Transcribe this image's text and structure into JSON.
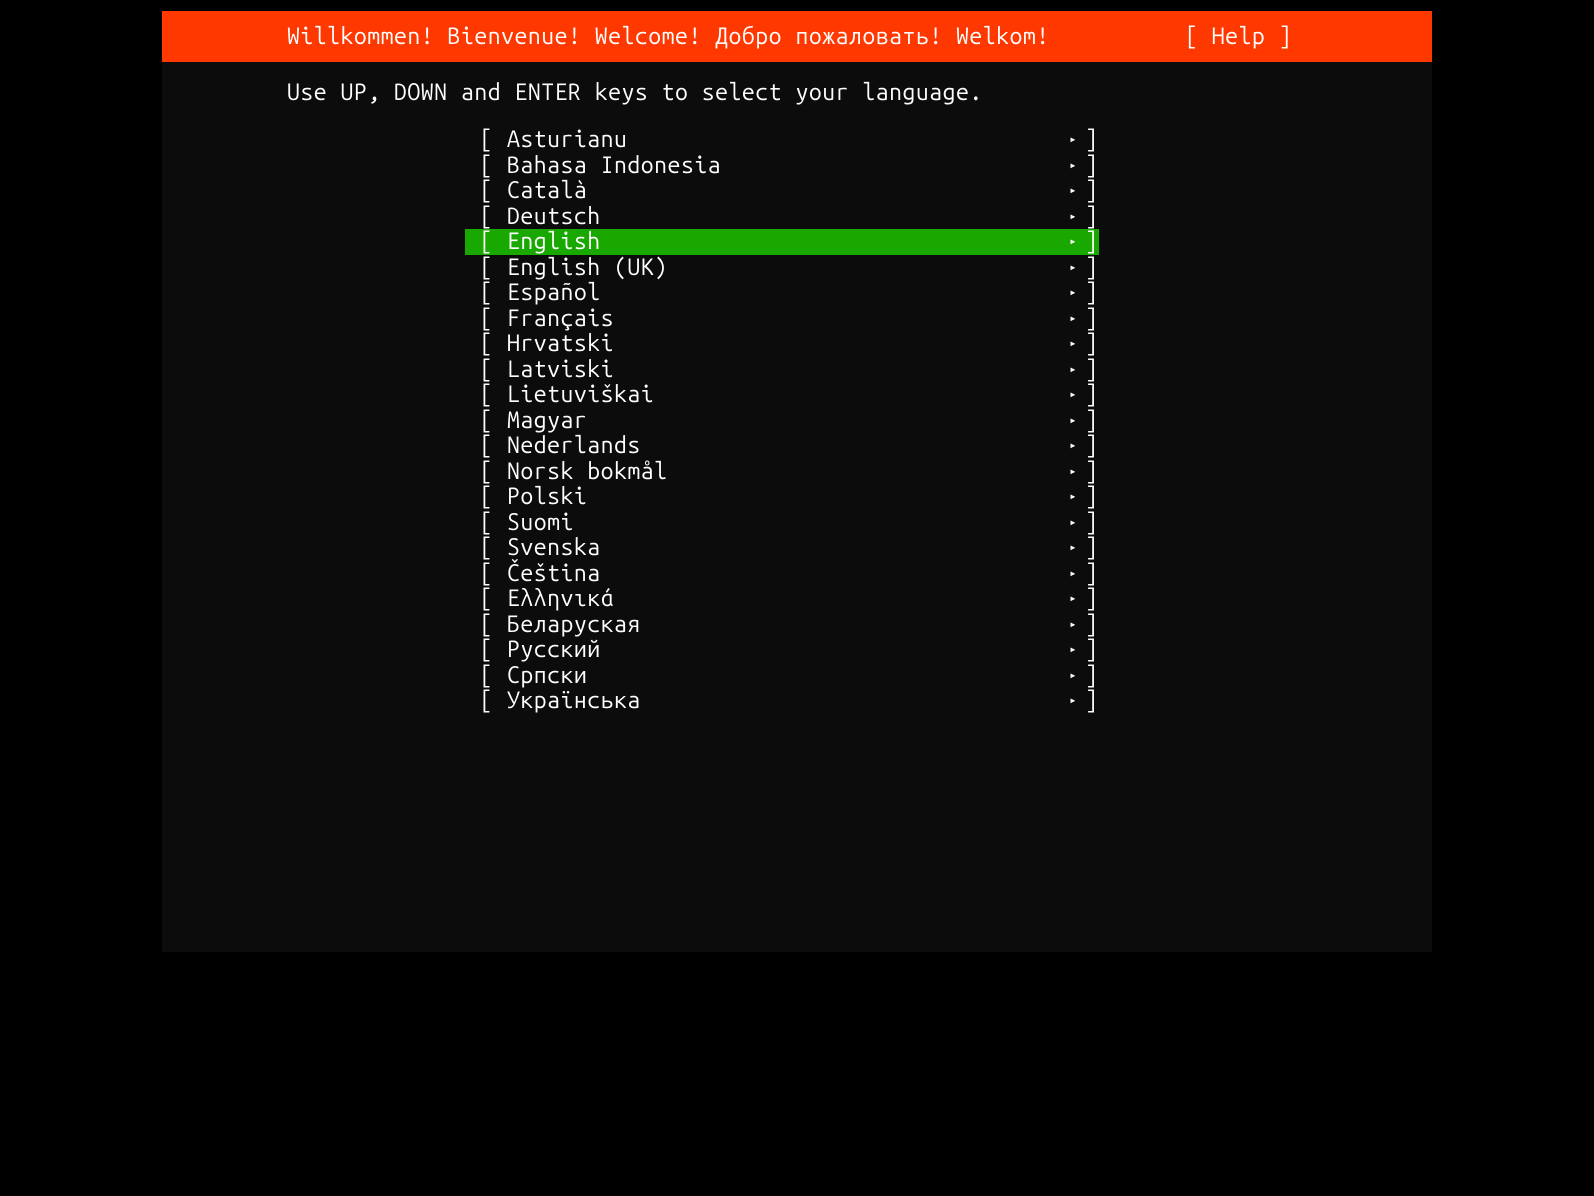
{
  "header": {
    "title": "Willkommen! Bienvenue! Welcome! Добро пожаловать! Welkom!",
    "help": "[ Help ]"
  },
  "instructions": "Use UP, DOWN and ENTER keys to select your language.",
  "selected_index": 4,
  "brackets": {
    "open": "[",
    "close": "]",
    "arrow": "▸"
  },
  "languages": [
    "Asturianu",
    "Bahasa Indonesia",
    "Català",
    "Deutsch",
    "English",
    "English (UK)",
    "Español",
    "Français",
    "Hrvatski",
    "Latviski",
    "Lietuviškai",
    "Magyar",
    "Nederlands",
    "Norsk bokmål",
    "Polski",
    "Suomi",
    "Svenska",
    "Čeština",
    "Ελληνικά",
    "Беларуская",
    "Русский",
    "Српски",
    "Українська"
  ]
}
